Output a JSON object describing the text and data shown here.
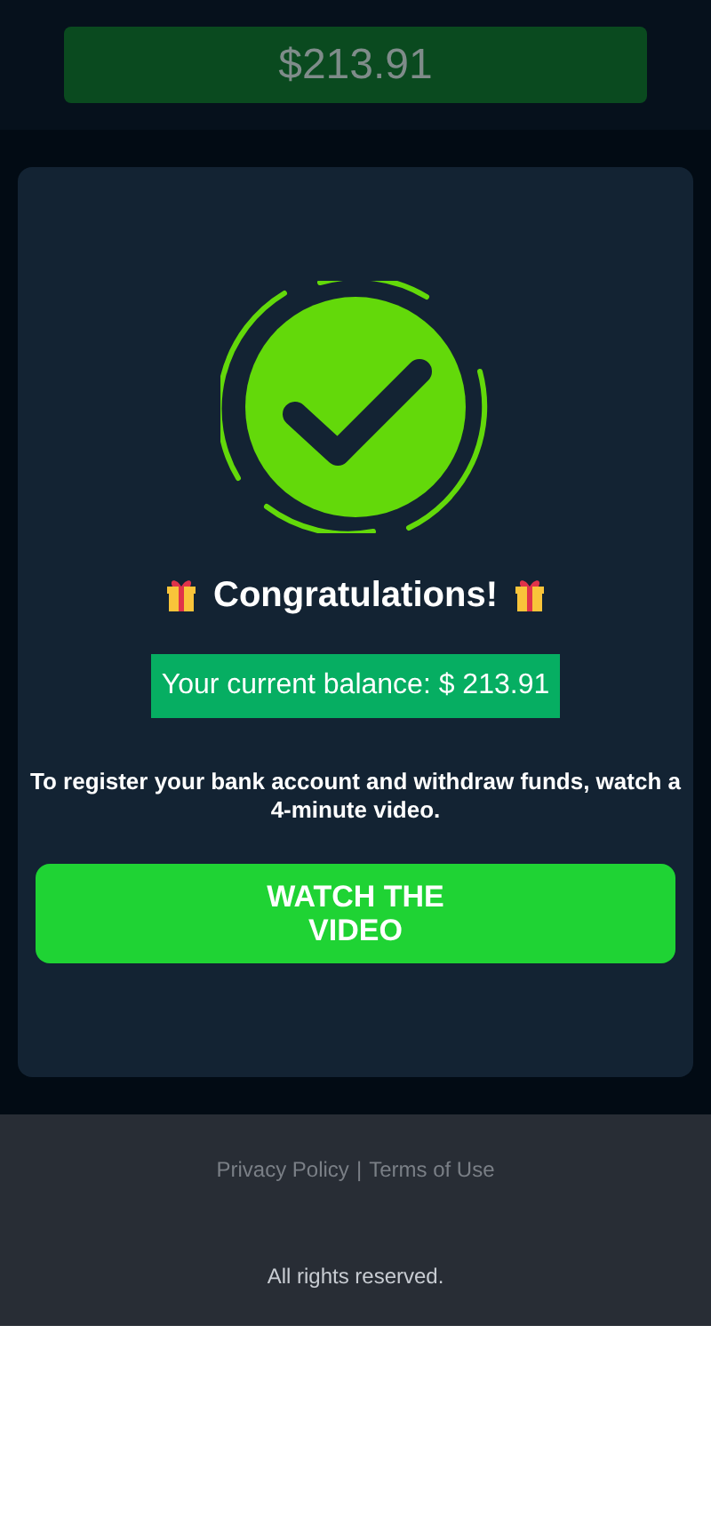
{
  "header": {
    "balance": "$213.91"
  },
  "card": {
    "title": "Congratulations!",
    "balance_text": "Your current balance: $ 213.91",
    "message": "To register your bank account and withdraw funds, watch a 4-minute video.",
    "button": "WATCH THE VIDEO"
  },
  "footer": {
    "links": [
      "Privacy Policy",
      "Terms of Use"
    ],
    "separator": "|",
    "copyright": "All rights reserved."
  }
}
